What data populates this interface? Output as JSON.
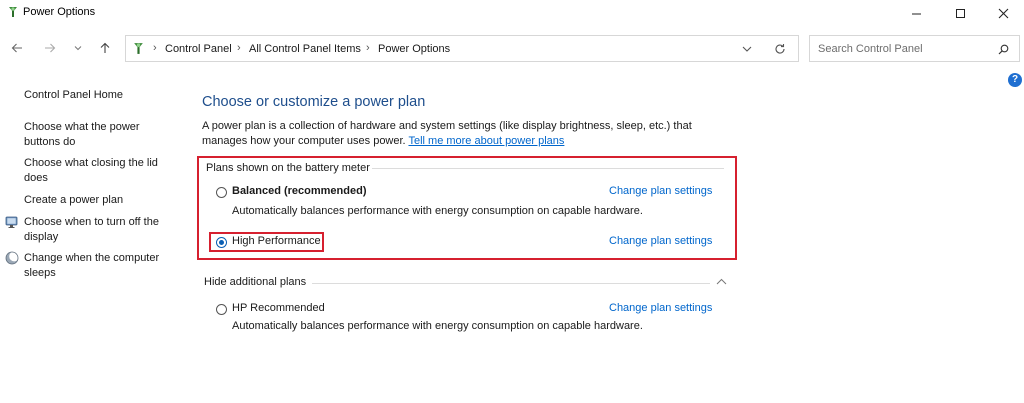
{
  "window": {
    "title": "Power Options"
  },
  "address": {
    "breadcrumbs": [
      "Control Panel",
      "All Control Panel Items",
      "Power Options"
    ],
    "search_placeholder": "Search Control Panel"
  },
  "sidebar": {
    "items": [
      {
        "label": "Control Panel Home"
      },
      {
        "label": "Choose what the power buttons do"
      },
      {
        "label": "Choose what closing the lid does"
      },
      {
        "label": "Create a power plan"
      },
      {
        "label": "Choose when to turn off the display",
        "icon": "monitor-icon"
      },
      {
        "label": "Change when the computer sleeps",
        "icon": "moon-sleep-icon"
      }
    ]
  },
  "main": {
    "heading": "Choose or customize a power plan",
    "description": "A power plan is a collection of hardware and system settings (like display brightness, sleep, etc.) that manages how your computer uses power.",
    "learn_more": "Tell me more about power plans",
    "battery_section_label": "Plans shown on the battery meter",
    "plans": [
      {
        "name": "Balanced (recommended)",
        "selected": false,
        "description": "Automatically balances performance with energy consumption on capable hardware.",
        "action": "Change plan settings"
      },
      {
        "name": "High Performance",
        "selected": true,
        "description": "",
        "action": "Change plan settings"
      }
    ],
    "additional_toggle": "Hide additional plans",
    "additional_plans": [
      {
        "name": "HP Recommended",
        "selected": false,
        "description": "Automatically balances performance with energy consumption on capable hardware.",
        "action": "Change plan settings"
      }
    ]
  },
  "colors": {
    "heading": "#1e4e8c",
    "link": "#0066cc",
    "highlight_border": "#d6202f",
    "radio_selected": "#0a5fb4"
  }
}
